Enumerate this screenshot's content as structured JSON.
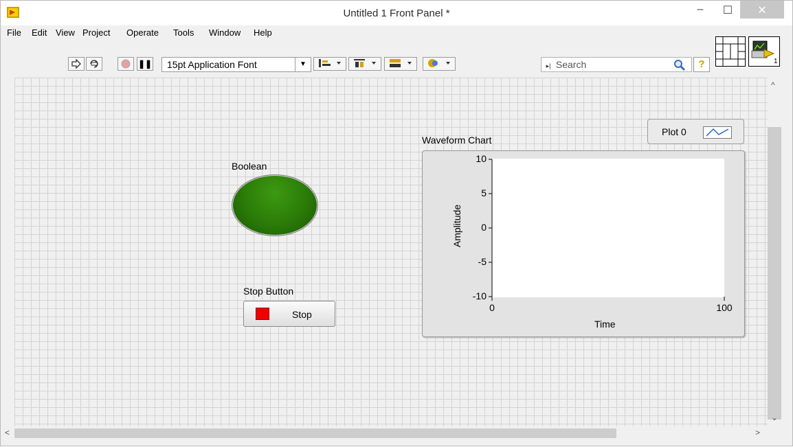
{
  "window": {
    "title": "Untitled 1 Front Panel *",
    "minimize_glyph": "–",
    "maximize_glyph": "☐",
    "close_glyph": "✕"
  },
  "menu": [
    "File",
    "Edit",
    "View",
    "Project",
    "Operate",
    "Tools",
    "Window",
    "Help"
  ],
  "toolbar": {
    "font_select": "15pt Application Font",
    "search_placeholder": "Search",
    "help_glyph": "?"
  },
  "icons": [
    "app-icon",
    "run-arrow-icon",
    "run-continuously-icon",
    "abort-icon",
    "pause-icon",
    "align-icon",
    "distribute-icon",
    "resize-icon",
    "reorder-icon",
    "search-icon",
    "help-icon",
    "connector-pane-icon",
    "vi-icon"
  ],
  "controls": {
    "boolean": {
      "label": "Boolean",
      "state": "on",
      "color": "#2a7a08"
    },
    "stop_button": {
      "label": "Stop Button",
      "text": "Stop",
      "color": "#ee0000"
    }
  },
  "chart_data": {
    "type": "line",
    "title": "Waveform Chart",
    "xlabel": "Time",
    "ylabel": "Amplitude",
    "xlim": [
      0,
      100
    ],
    "ylim": [
      -10,
      10
    ],
    "x_ticks": [
      "0",
      "100"
    ],
    "y_ticks": [
      "10",
      "5",
      "0",
      "-5",
      "-10"
    ],
    "series": [
      {
        "name": "Plot 0",
        "values": []
      }
    ],
    "legend": "top-right",
    "grid": false
  },
  "scroll": {
    "up": "^",
    "down": "⌄",
    "left": "<",
    "right": ">"
  }
}
